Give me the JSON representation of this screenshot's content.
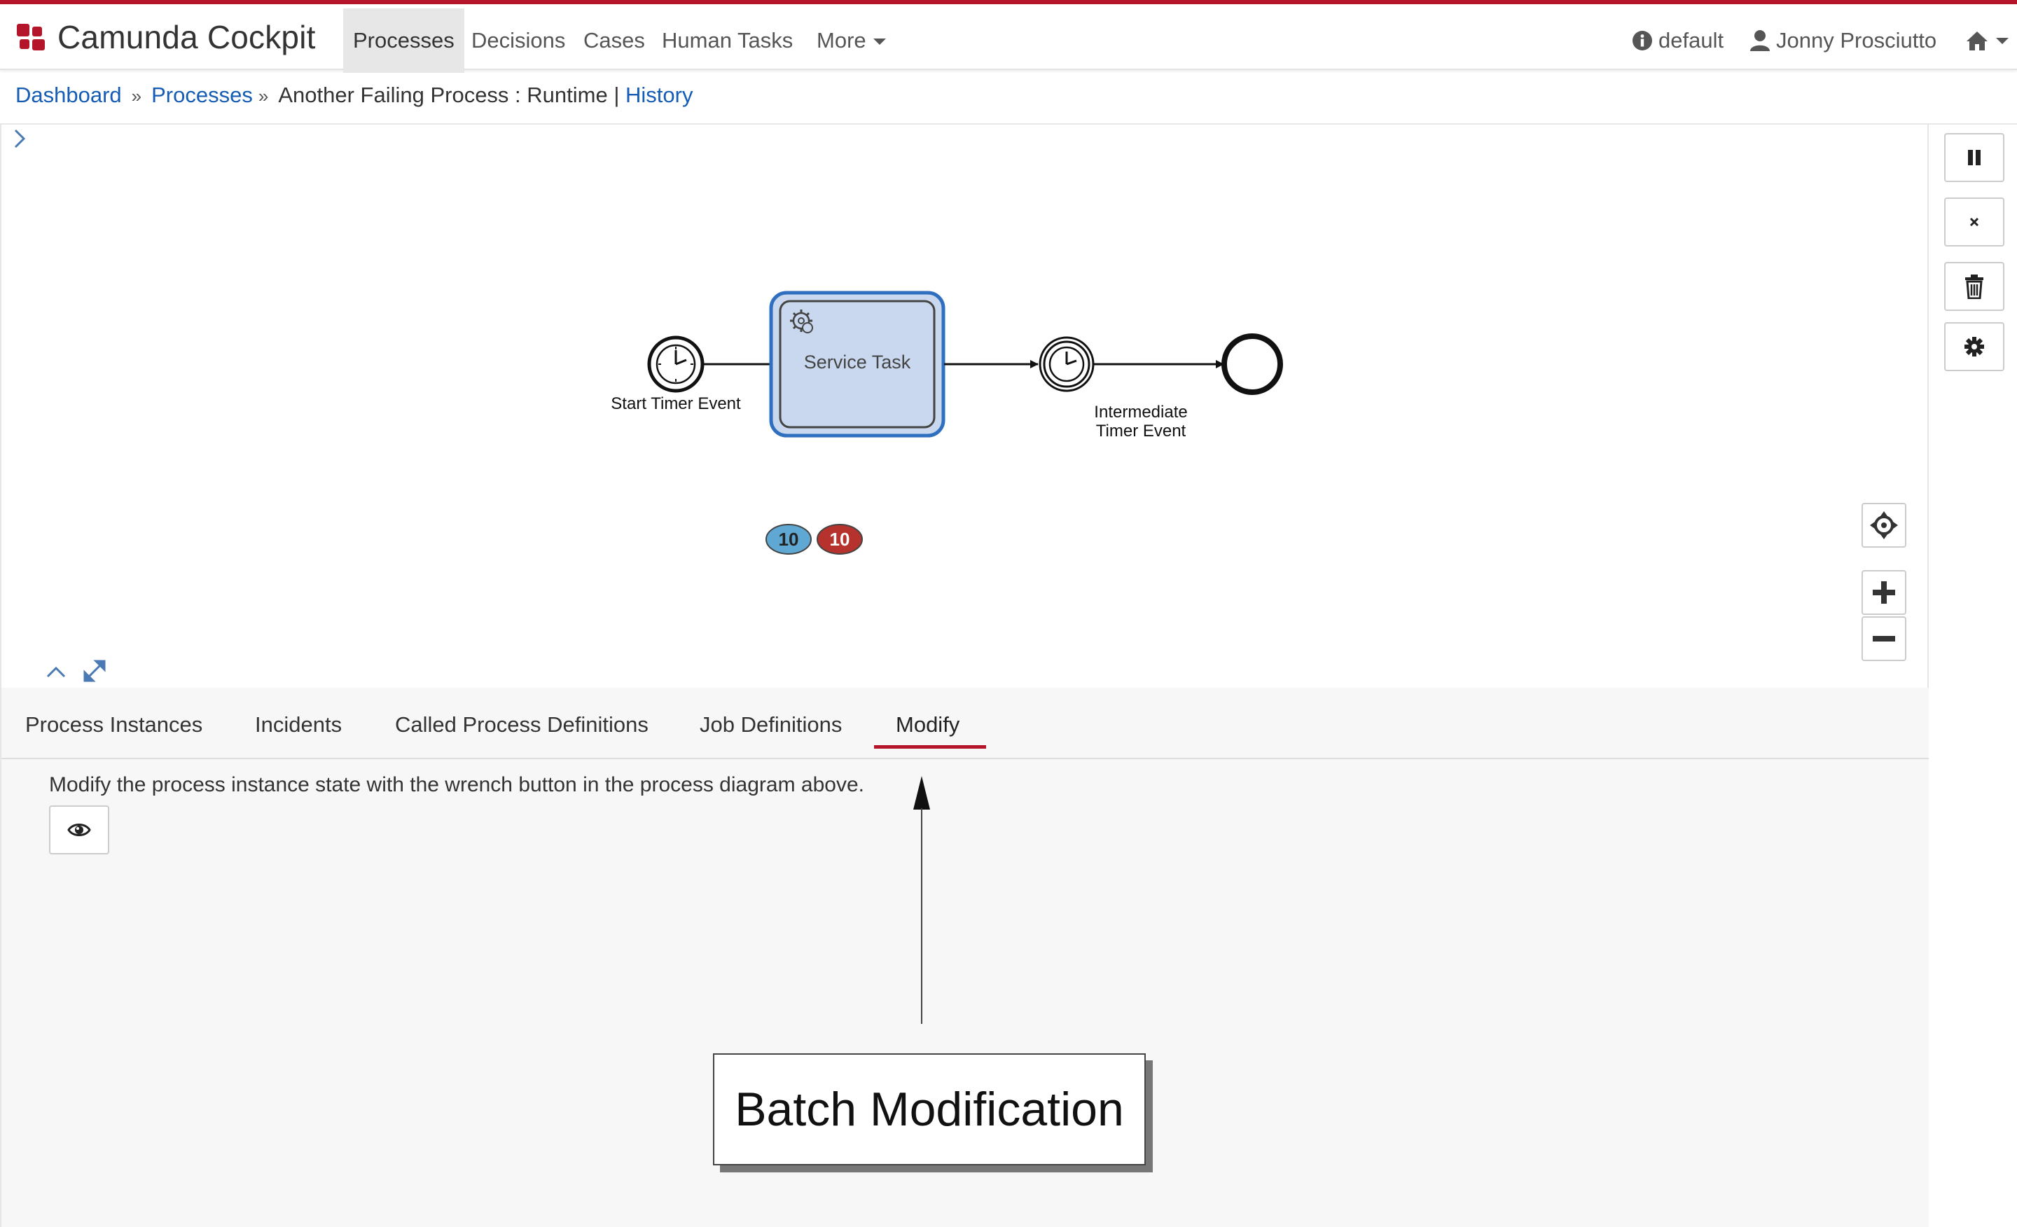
{
  "app": {
    "title": "Camunda Cockpit",
    "brand_color": "#b5152b"
  },
  "nav": {
    "items": [
      {
        "label": "Processes",
        "active": true
      },
      {
        "label": "Decisions"
      },
      {
        "label": "Cases"
      },
      {
        "label": "Human Tasks"
      },
      {
        "label": "More"
      }
    ],
    "right": {
      "engine": "default",
      "user": "Jonny Prosciutto"
    }
  },
  "breadcrumb": {
    "dashboard": "Dashboard",
    "processes": "Processes",
    "sep": "»",
    "current": "Another Failing Process : Runtime",
    "pipe": "|",
    "history": "History"
  },
  "diagram": {
    "start_event_label": "Start Timer Event",
    "service_task_label": "Service Task",
    "running_count": "10",
    "incident_count": "10",
    "intermediate_label_1": "Intermediate",
    "intermediate_label_2": "Timer Event",
    "running_badge_color": "#5fa8d3",
    "incident_badge_color": "#b5322d"
  },
  "tabs": {
    "items": [
      {
        "label": "Process Instances"
      },
      {
        "label": "Incidents"
      },
      {
        "label": "Called Process Definitions"
      },
      {
        "label": "Job Definitions"
      },
      {
        "label": "Modify",
        "active": true
      }
    ]
  },
  "modify": {
    "description": "Modify the process instance state with the wrench button in the process diagram above."
  },
  "annotation": {
    "label": "Batch Modification"
  }
}
